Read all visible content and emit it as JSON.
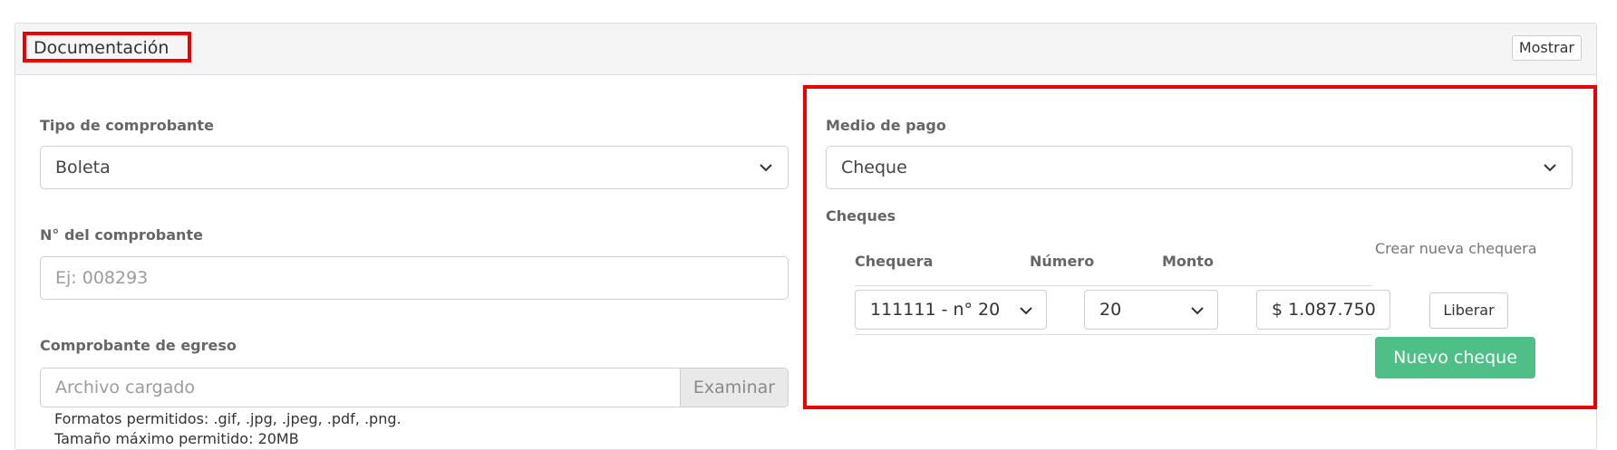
{
  "header": {
    "title": "Documentación",
    "show_button": "Mostrar"
  },
  "left": {
    "voucher_type": {
      "label": "Tipo de comprobante",
      "value": "Boleta"
    },
    "voucher_number": {
      "label": "N° del comprobante",
      "placeholder": "Ej: 008293"
    },
    "expense_voucher": {
      "label": "Comprobante de egreso",
      "file_placeholder": "Archivo cargado",
      "browse_button": "Examinar",
      "note_formats": "Formatos permitidos: .gif, .jpg, .jpeg, .pdf, .png.",
      "note_size": "Tamaño máximo permitido: 20MB"
    }
  },
  "right": {
    "payment_method": {
      "label": "Medio de pago",
      "value": "Cheque"
    },
    "checks": {
      "label": "Cheques",
      "create_link": "Crear nueva chequera",
      "columns": [
        "Chequera",
        "Número",
        "Monto"
      ],
      "rows": [
        {
          "checkbook": "111111 - n° 20",
          "number": "20",
          "amount": "$ 1.087.750",
          "release": "Liberar"
        }
      ],
      "new_button": "Nuevo cheque"
    }
  },
  "colors": {
    "highlight": "#ee0000",
    "success": "#4fbf88"
  }
}
